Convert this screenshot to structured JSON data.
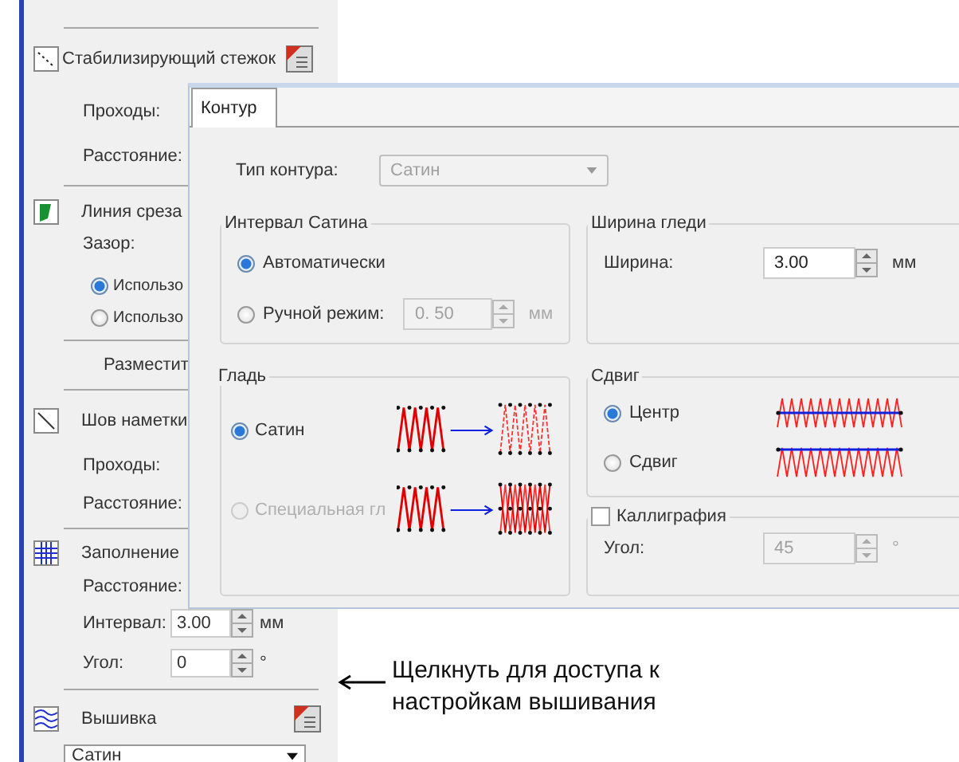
{
  "side_panel": {
    "stabilizing": {
      "title": "Стабилизирующий стежок",
      "passes_label": "Проходы:",
      "spacing_label": "Расстояние:"
    },
    "cut_line": {
      "title": "Линия среза",
      "gap_label": "Зазор:",
      "options": [
        {
          "label": "Использо",
          "selected": true
        },
        {
          "label": "Использо",
          "selected": false
        }
      ]
    },
    "place_label": "Разместит",
    "basting": {
      "title": "Шов наметки",
      "passes_label": "Проходы:",
      "spacing_label": "Расстояние:"
    },
    "fill": {
      "title": "Заполнение",
      "spacing_label": "Расстояние:",
      "interval_label": "Интервал:",
      "interval_value": "3.00",
      "interval_unit": "мм",
      "angle_label": "Угол:",
      "angle_value": "0",
      "angle_unit": "°"
    },
    "embroidery": {
      "title": "Вышивка",
      "type_value": "Сатин"
    }
  },
  "dialog": {
    "tabs": [
      {
        "label": "Контур",
        "selected": true
      }
    ],
    "outline_type": {
      "label": "Тип контура:",
      "value": "Сатин",
      "disabled": true
    },
    "satin_spacing": {
      "title": "Интервал Сатина",
      "options": [
        {
          "label": "Автоматически",
          "selected": true
        },
        {
          "label": "Ручной режим:",
          "selected": false
        }
      ],
      "manual_value": "0. 50",
      "manual_unit": "мм"
    },
    "satin_width": {
      "title": "Ширина гледи",
      "width_label": "Ширина:",
      "width_value": "3.00",
      "unit": "мм"
    },
    "satin": {
      "title": "Гладь",
      "options": [
        {
          "label": "Сатин",
          "selected": true,
          "disabled": false
        },
        {
          "label": "Специальная гл",
          "selected": false,
          "disabled": true
        }
      ]
    },
    "offset": {
      "title": "Сдвиг",
      "options": [
        {
          "label": "Центр",
          "selected": true
        },
        {
          "label": "Сдвиг",
          "selected": false
        }
      ]
    },
    "calligraphy": {
      "label": "Каллиграфия",
      "checked": false,
      "angle_label": "Угол:",
      "angle_value": "45",
      "angle_unit": "°"
    }
  },
  "annotation": {
    "text": "Щелкнуть для доступа к настройкам вышивания"
  }
}
